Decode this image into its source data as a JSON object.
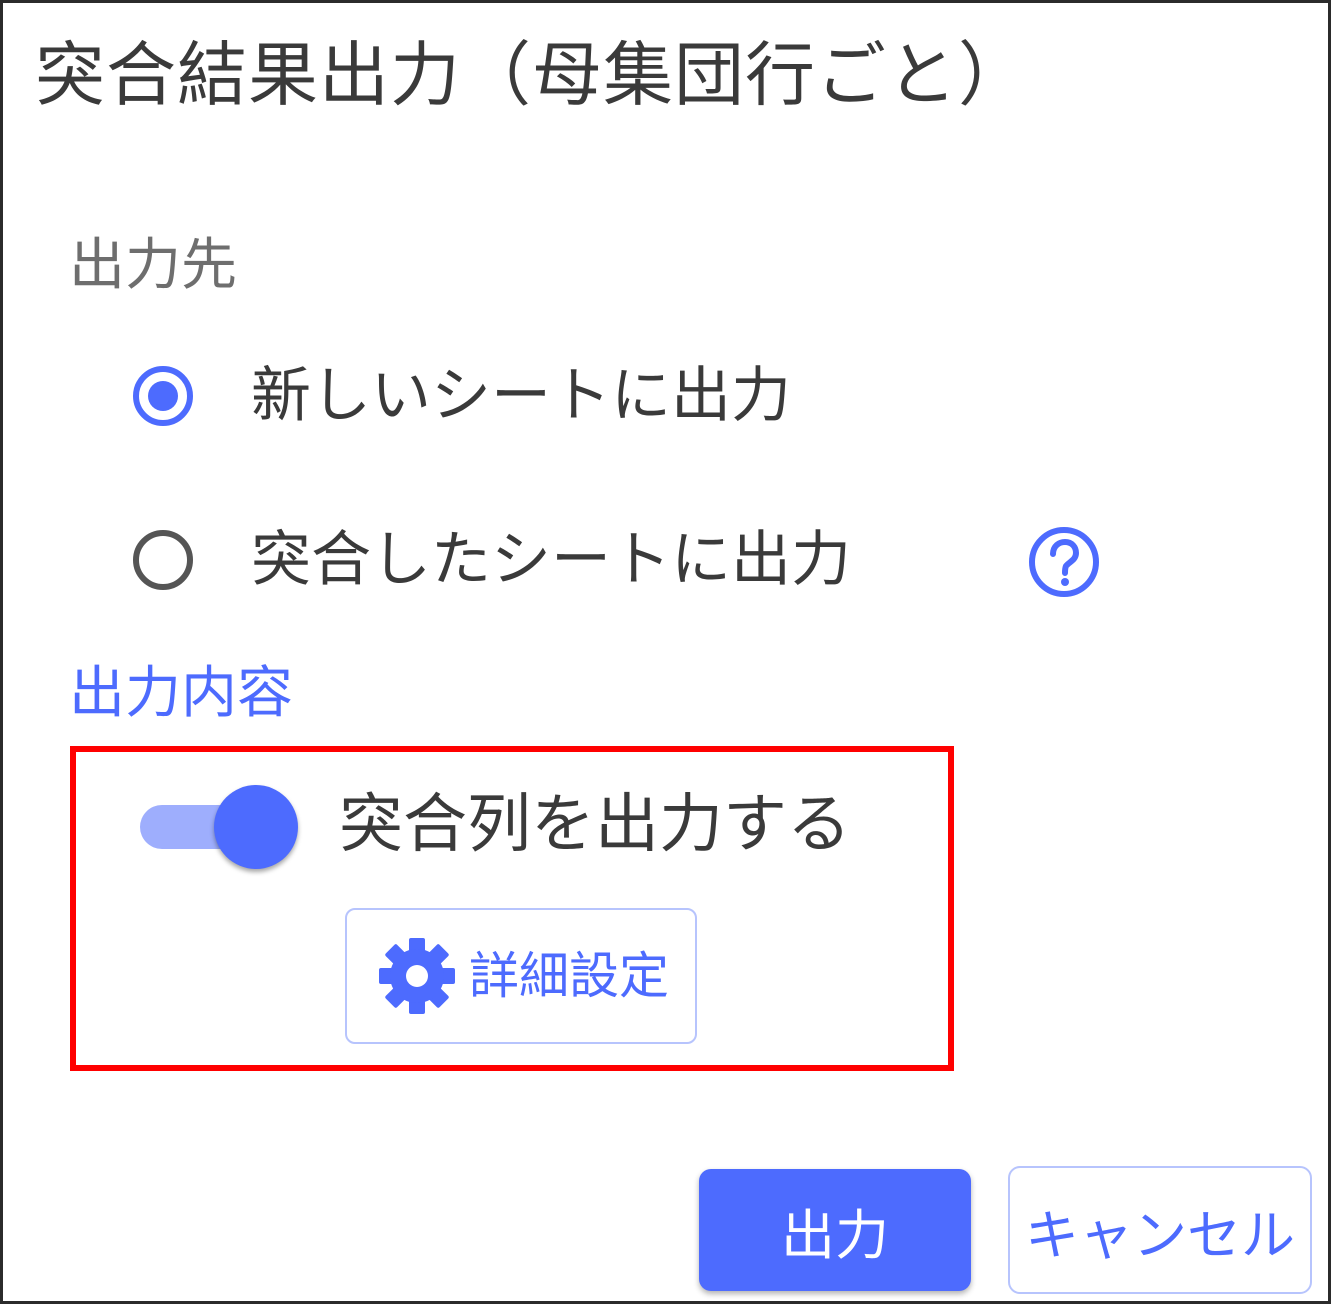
{
  "dialog": {
    "title": "突合結果出力（母集団行ごと）"
  },
  "output_destination": {
    "label": "出力先",
    "options": [
      {
        "label": "新しいシートに出力",
        "selected": true
      },
      {
        "label": "突合したシートに出力",
        "selected": false
      }
    ],
    "help_icon": "question-circle-icon"
  },
  "output_content": {
    "label": "出力内容",
    "toggle": {
      "label": "突合列を出力する",
      "on": true
    },
    "detail_button": {
      "label": "詳細設定",
      "icon": "gear-icon"
    }
  },
  "footer": {
    "primary_label": "出力",
    "cancel_label": "キャンセル"
  },
  "colors": {
    "accent": "#4d6bfe",
    "toggle_track": "#9eaefd",
    "highlight": "#ff0000",
    "muted_text": "#6e6e6e"
  }
}
